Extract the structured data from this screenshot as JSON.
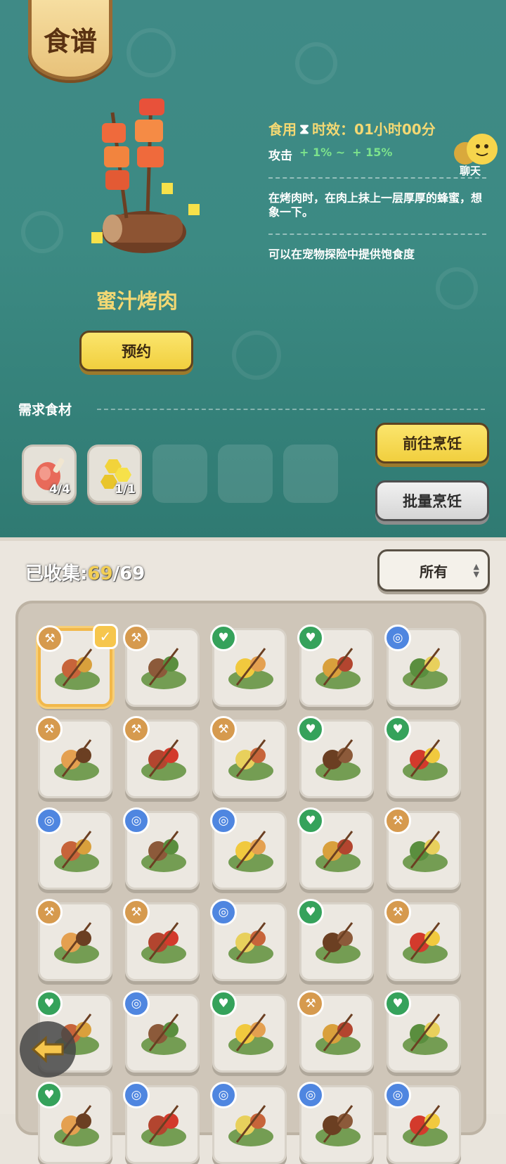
{
  "header": {
    "title": "食谱"
  },
  "dish": {
    "name": "蜜汁烤肉",
    "reserve_label": "预约",
    "effect_prefix": "食用",
    "effect_suffix": "时效：01小时00分",
    "attack_label": "攻击",
    "attack_min": "+ 1% ~",
    "attack_max": "+ 15%",
    "description": "在烤肉时，在肉上抹上一层厚厚的蜂蜜，想象一下。",
    "usage": "可以在宠物探险中提供饱食度"
  },
  "chat": {
    "label": "聊天"
  },
  "ingredients": {
    "label": "需求食材",
    "items": [
      {
        "icon": "meat-icon",
        "qty": "4/4"
      },
      {
        "icon": "honeycomb-icon",
        "qty": "1/1"
      }
    ]
  },
  "actions": {
    "goto_cook": "前往烹饪",
    "batch_cook": "批量烹饪"
  },
  "collection": {
    "label": "已收集:",
    "count": "69",
    "total": "/69",
    "filter": "所有"
  },
  "colors": {
    "axe": "#d69a4e",
    "heart": "#35a25b",
    "spiral": "#4f86e0",
    "accent": "#f3d873"
  },
  "recipes": [
    {
      "tag": "axe",
      "dish": "skewer-mixed",
      "selected": true
    },
    {
      "tag": "axe",
      "dish": "skewer-meat"
    },
    {
      "tag": "heart",
      "dish": "skewer-veg"
    },
    {
      "tag": "heart",
      "dish": "bowl-yellow"
    },
    {
      "tag": "spiral",
      "dish": "fish-skewer"
    },
    {
      "tag": "axe",
      "dish": "drumstick"
    },
    {
      "tag": "axe",
      "dish": "ham"
    },
    {
      "tag": "axe",
      "dish": "fried-eggs"
    },
    {
      "tag": "heart",
      "dish": "mushroom-skewer"
    },
    {
      "tag": "heart",
      "dish": "pepper-skewer"
    },
    {
      "tag": "spiral",
      "dish": "scallops"
    },
    {
      "tag": "spiral",
      "dish": "shrimp-skewer"
    },
    {
      "tag": "spiral",
      "dish": "grapes"
    },
    {
      "tag": "heart",
      "dish": "bowl-lemon"
    },
    {
      "tag": "axe",
      "dish": "pizza"
    },
    {
      "tag": "axe",
      "dish": "fruit-plate"
    },
    {
      "tag": "axe",
      "dish": "meat-platter"
    },
    {
      "tag": "spiral",
      "dish": "seafood-bowl"
    },
    {
      "tag": "heart",
      "dish": "fruit-bowl"
    },
    {
      "tag": "axe",
      "dish": "mushroom-stand"
    },
    {
      "tag": "heart",
      "dish": "bowl-honey"
    },
    {
      "tag": "spiral",
      "dish": "seafood-platter"
    },
    {
      "tag": "heart",
      "dish": "bowl-honey-2"
    },
    {
      "tag": "axe",
      "dish": "veggie-platter"
    },
    {
      "tag": "heart",
      "dish": "pepper-salad"
    },
    {
      "tag": "heart",
      "dish": "partial"
    },
    {
      "tag": "spiral",
      "dish": "partial"
    },
    {
      "tag": "spiral",
      "dish": "partial"
    },
    {
      "tag": "spiral",
      "dish": "partial"
    },
    {
      "tag": "spiral",
      "dish": "partial"
    }
  ]
}
